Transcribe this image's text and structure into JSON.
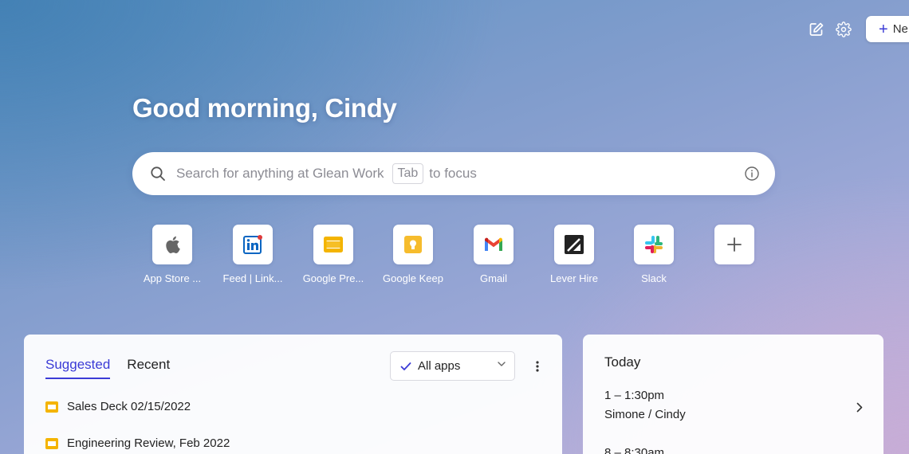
{
  "toolbar": {
    "edit_icon": "edit-icon",
    "settings_icon": "gear-icon",
    "new_button_label": "Ne"
  },
  "greeting": "Good morning, Cindy",
  "search": {
    "placeholder": "Search for anything at Glean Work",
    "tab_key": "Tab",
    "focus_hint": "to focus"
  },
  "shortcuts": [
    {
      "label": "App Store ...",
      "icon": "apple-icon"
    },
    {
      "label": "Feed | Link...",
      "icon": "linkedin-icon"
    },
    {
      "label": "Google Pre...",
      "icon": "google-slides-icon"
    },
    {
      "label": "Google Keep",
      "icon": "google-keep-icon"
    },
    {
      "label": "Gmail",
      "icon": "gmail-icon"
    },
    {
      "label": "Lever Hire",
      "icon": "lever-icon"
    },
    {
      "label": "Slack",
      "icon": "slack-icon"
    },
    {
      "label": "",
      "icon": "plus-icon"
    }
  ],
  "suggested": {
    "tabs": [
      "Suggested",
      "Recent"
    ],
    "active_tab": "Suggested",
    "filter_label": "All apps",
    "items": [
      {
        "label": "Sales Deck 02/15/2022",
        "icon": "google-slides-icon"
      },
      {
        "label": "Engineering Review, Feb 2022",
        "icon": "google-slides-icon"
      }
    ]
  },
  "today": {
    "title": "Today",
    "events": [
      {
        "time": "1 – 1:30pm",
        "title": "Simone / Cindy"
      },
      {
        "time": "8 – 8:30am",
        "title": ""
      }
    ]
  },
  "colors": {
    "accent": "#3b3bd6",
    "slides_yellow": "#f4b400"
  }
}
